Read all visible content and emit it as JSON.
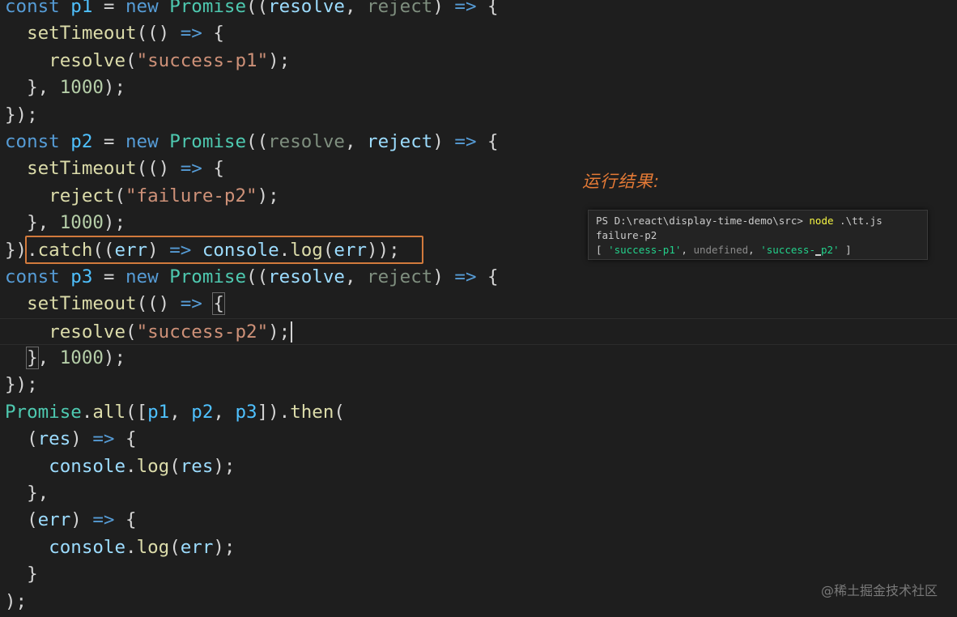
{
  "colors": {
    "background": "#1e1e1e",
    "keyword": "#569cd6",
    "variable": "#4fc1ff",
    "class": "#4ec9b0",
    "function": "#dcdcaa",
    "parameter": "#9cdcfe",
    "string": "#ce9178",
    "number": "#b5cea8",
    "unused_param": "#7f8f7f",
    "text": "#d4d4d4",
    "highlight_border": "#d27a3c",
    "annotation": "#e47a36",
    "term_green": "#23d18b",
    "term_yellow": "#f5f543",
    "term_gray": "#8a8a8a"
  },
  "editor": {
    "lines": [
      [
        [
          "const",
          "keyword"
        ],
        [
          " ",
          "text"
        ],
        [
          "p1",
          "variable"
        ],
        [
          " = ",
          "text"
        ],
        [
          "new",
          "keyword"
        ],
        [
          " ",
          "text"
        ],
        [
          "Promise",
          "class"
        ],
        [
          "((",
          "text"
        ],
        [
          "resolve",
          "parameter"
        ],
        [
          ", ",
          "text"
        ],
        [
          "reject",
          "unused_param"
        ],
        [
          ") ",
          "text"
        ],
        [
          "=>",
          "keyword"
        ],
        [
          " {",
          "text"
        ]
      ],
      [
        [
          "  ",
          "text"
        ],
        [
          "setTimeout",
          "function"
        ],
        [
          "(() ",
          "text"
        ],
        [
          "=>",
          "keyword"
        ],
        [
          " {",
          "text"
        ]
      ],
      [
        [
          "    ",
          "text"
        ],
        [
          "resolve",
          "function"
        ],
        [
          "(",
          "text"
        ],
        [
          "\"success-p1\"",
          "string"
        ],
        [
          ");",
          "text"
        ]
      ],
      [
        [
          "  }, ",
          "text"
        ],
        [
          "1000",
          "number"
        ],
        [
          ");",
          "text"
        ]
      ],
      [
        [
          "});",
          "text"
        ]
      ],
      [
        [
          "const",
          "keyword"
        ],
        [
          " ",
          "text"
        ],
        [
          "p2",
          "variable"
        ],
        [
          " = ",
          "text"
        ],
        [
          "new",
          "keyword"
        ],
        [
          " ",
          "text"
        ],
        [
          "Promise",
          "class"
        ],
        [
          "((",
          "text"
        ],
        [
          "resolve",
          "unused_param"
        ],
        [
          ", ",
          "text"
        ],
        [
          "reject",
          "parameter"
        ],
        [
          ") ",
          "text"
        ],
        [
          "=>",
          "keyword"
        ],
        [
          " {",
          "text"
        ]
      ],
      [
        [
          "  ",
          "text"
        ],
        [
          "setTimeout",
          "function"
        ],
        [
          "(() ",
          "text"
        ],
        [
          "=>",
          "keyword"
        ],
        [
          " {",
          "text"
        ]
      ],
      [
        [
          "    ",
          "text"
        ],
        [
          "reject",
          "function"
        ],
        [
          "(",
          "text"
        ],
        [
          "\"failure-p2\"",
          "string"
        ],
        [
          ");",
          "text"
        ]
      ],
      [
        [
          "  }, ",
          "text"
        ],
        [
          "1000",
          "number"
        ],
        [
          ");",
          "text"
        ]
      ],
      [
        [
          "})",
          "text"
        ],
        [
          ".",
          "text"
        ],
        [
          "catch",
          "function"
        ],
        [
          "((",
          "text"
        ],
        [
          "err",
          "parameter"
        ],
        [
          ") ",
          "text"
        ],
        [
          "=>",
          "keyword"
        ],
        [
          " ",
          "text"
        ],
        [
          "console",
          "parameter"
        ],
        [
          ".",
          "text"
        ],
        [
          "log",
          "function"
        ],
        [
          "(",
          "text"
        ],
        [
          "err",
          "parameter"
        ],
        [
          "));",
          "text"
        ]
      ],
      [
        [
          "const",
          "keyword"
        ],
        [
          " ",
          "text"
        ],
        [
          "p3",
          "variable"
        ],
        [
          " = ",
          "text"
        ],
        [
          "new",
          "keyword"
        ],
        [
          " ",
          "text"
        ],
        [
          "Promise",
          "class"
        ],
        [
          "((",
          "text"
        ],
        [
          "resolve",
          "parameter"
        ],
        [
          ", ",
          "text"
        ],
        [
          "reject",
          "unused_param"
        ],
        [
          ") ",
          "text"
        ],
        [
          "=>",
          "keyword"
        ],
        [
          " {",
          "text"
        ]
      ],
      [
        [
          "  ",
          "text"
        ],
        [
          "setTimeout",
          "function"
        ],
        [
          "(() ",
          "text"
        ],
        [
          "=>",
          "keyword"
        ],
        [
          " ",
          "text"
        ],
        [
          "{",
          "text"
        ]
      ],
      [
        [
          "    ",
          "text"
        ],
        [
          "resolve",
          "function"
        ],
        [
          "(",
          "text"
        ],
        [
          "\"success-p2\"",
          "string"
        ],
        [
          ");",
          "text"
        ]
      ],
      [
        [
          "  ",
          "text"
        ],
        [
          "}",
          "text"
        ],
        [
          ", ",
          "text"
        ],
        [
          "1000",
          "number"
        ],
        [
          ");",
          "text"
        ]
      ],
      [
        [
          "});",
          "text"
        ]
      ],
      [
        [
          "Promise",
          "class"
        ],
        [
          ".",
          "text"
        ],
        [
          "all",
          "function"
        ],
        [
          "([",
          "text"
        ],
        [
          "p1",
          "variable"
        ],
        [
          ", ",
          "text"
        ],
        [
          "p2",
          "variable"
        ],
        [
          ", ",
          "text"
        ],
        [
          "p3",
          "variable"
        ],
        [
          "]).",
          "text"
        ],
        [
          "then",
          "function"
        ],
        [
          "(",
          "text"
        ]
      ],
      [
        [
          "  (",
          "text"
        ],
        [
          "res",
          "parameter"
        ],
        [
          ") ",
          "text"
        ],
        [
          "=>",
          "keyword"
        ],
        [
          " {",
          "text"
        ]
      ],
      [
        [
          "    ",
          "text"
        ],
        [
          "console",
          "parameter"
        ],
        [
          ".",
          "text"
        ],
        [
          "log",
          "function"
        ],
        [
          "(",
          "text"
        ],
        [
          "res",
          "parameter"
        ],
        [
          ");",
          "text"
        ]
      ],
      [
        [
          "  },",
          "text"
        ]
      ],
      [
        [
          "  (",
          "text"
        ],
        [
          "err",
          "parameter"
        ],
        [
          ") ",
          "text"
        ],
        [
          "=>",
          "keyword"
        ],
        [
          " {",
          "text"
        ]
      ],
      [
        [
          "    ",
          "text"
        ],
        [
          "console",
          "parameter"
        ],
        [
          ".",
          "text"
        ],
        [
          "log",
          "function"
        ],
        [
          "(",
          "text"
        ],
        [
          "err",
          "parameter"
        ],
        [
          ");",
          "text"
        ]
      ],
      [
        [
          "  }",
          "text"
        ]
      ],
      [
        [
          ");",
          "text"
        ]
      ]
    ]
  },
  "annotation": {
    "result_label": "运行结果:"
  },
  "terminal": {
    "prompt": "PS D:\\react\\display-time-demo\\src> ",
    "command": "node",
    "args": " .\\tt.js",
    "output_line": "failure-p2",
    "array_open": "[ ",
    "item1": "'success-p1'",
    "sep1": ", ",
    "item2": "undefined",
    "sep2": ", ",
    "item3_a": "'success-",
    "item3_b": "p2'",
    "array_close": " ]"
  },
  "watermark": "@稀土掘金技术社区"
}
